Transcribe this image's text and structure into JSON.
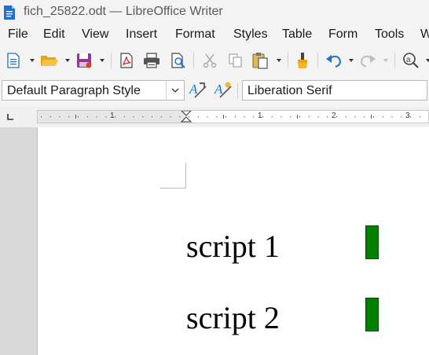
{
  "window": {
    "title": "fich_25822.odt — LibreOffice Writer"
  },
  "menu": {
    "items": [
      "File",
      "Edit",
      "View",
      "Insert",
      "Format",
      "Styles",
      "Table",
      "Form",
      "Tools",
      "W"
    ]
  },
  "toolbar": {
    "icons": [
      "new-document-icon",
      "open-folder-icon",
      "save-icon",
      "export-pdf-icon",
      "print-icon",
      "print-preview-icon",
      "cut-icon",
      "copy-icon",
      "paste-icon",
      "clone-formatting-icon",
      "undo-icon",
      "redo-icon",
      "find-replace-icon"
    ]
  },
  "formatting": {
    "paragraph_style": "Default Paragraph Style",
    "font_name": "Liberation Serif"
  },
  "ruler": {
    "numbers": [
      "1",
      "1",
      "2",
      "3"
    ]
  },
  "document": {
    "lines": [
      {
        "text": "script 1",
        "marker_color": "#008000"
      },
      {
        "text": "script 2",
        "marker_color": "#008000"
      }
    ]
  },
  "colors": {
    "accent_blue": "#1e6fd9",
    "save_purple": "#8e3a8e",
    "marker_green": "#008000"
  }
}
